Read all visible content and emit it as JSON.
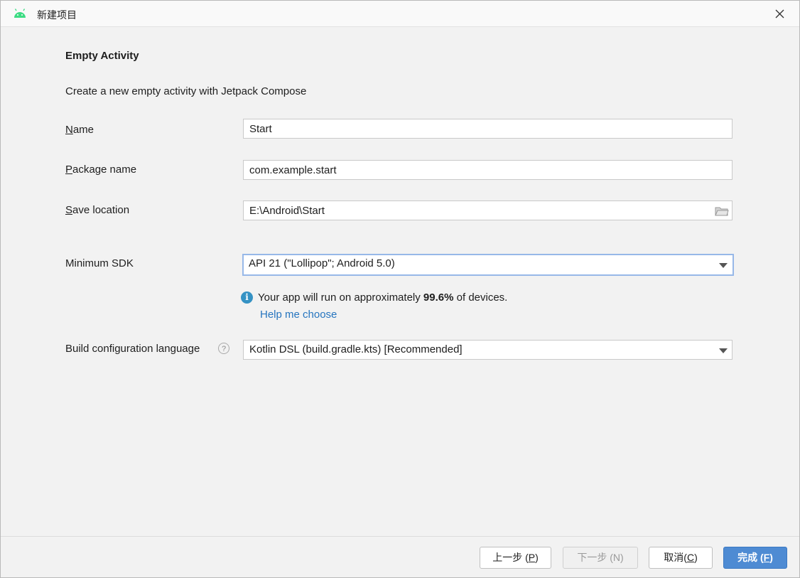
{
  "window": {
    "title": "新建项目",
    "icon": "android-icon",
    "close_icon": "close-icon"
  },
  "form": {
    "heading": "Empty Activity",
    "description": "Create a new empty activity with Jetpack Compose",
    "name": {
      "label_mnemonic": "N",
      "label_rest": "ame",
      "value": "Start"
    },
    "package": {
      "label_mnemonic": "P",
      "label_rest": "ackage name",
      "value": "com.example.start"
    },
    "save_location": {
      "label_mnemonic": "S",
      "label_rest": "ave location",
      "value": "E:\\Android\\Start",
      "icon": "folder-icon"
    },
    "min_sdk": {
      "label": "Minimum SDK",
      "value": "API 21 (\"Lollipop\"; Android 5.0)"
    },
    "info": {
      "icon": "info-icon",
      "text_before": "Your app will run on approximately ",
      "percent": "99.6%",
      "text_after": " of devices.",
      "help_link": "Help me choose"
    },
    "build_language": {
      "label": "Build configuration language",
      "help_icon": "help-icon",
      "value": "Kotlin DSL (build.gradle.kts) [Recommended]"
    }
  },
  "buttons": {
    "previous": {
      "text": "上一步 (",
      "mnemonic": "P",
      "close": ")"
    },
    "next": {
      "text": "下一步 (N)"
    },
    "cancel": {
      "text": "取消(",
      "mnemonic": "C",
      "close": ")"
    },
    "finish": {
      "text": "完成 (",
      "mnemonic": "F",
      "close": ")"
    }
  },
  "colors": {
    "accent": "#4e8bd3",
    "link": "#2675bf",
    "info": "#3592c4",
    "android": "#3ddc84"
  }
}
